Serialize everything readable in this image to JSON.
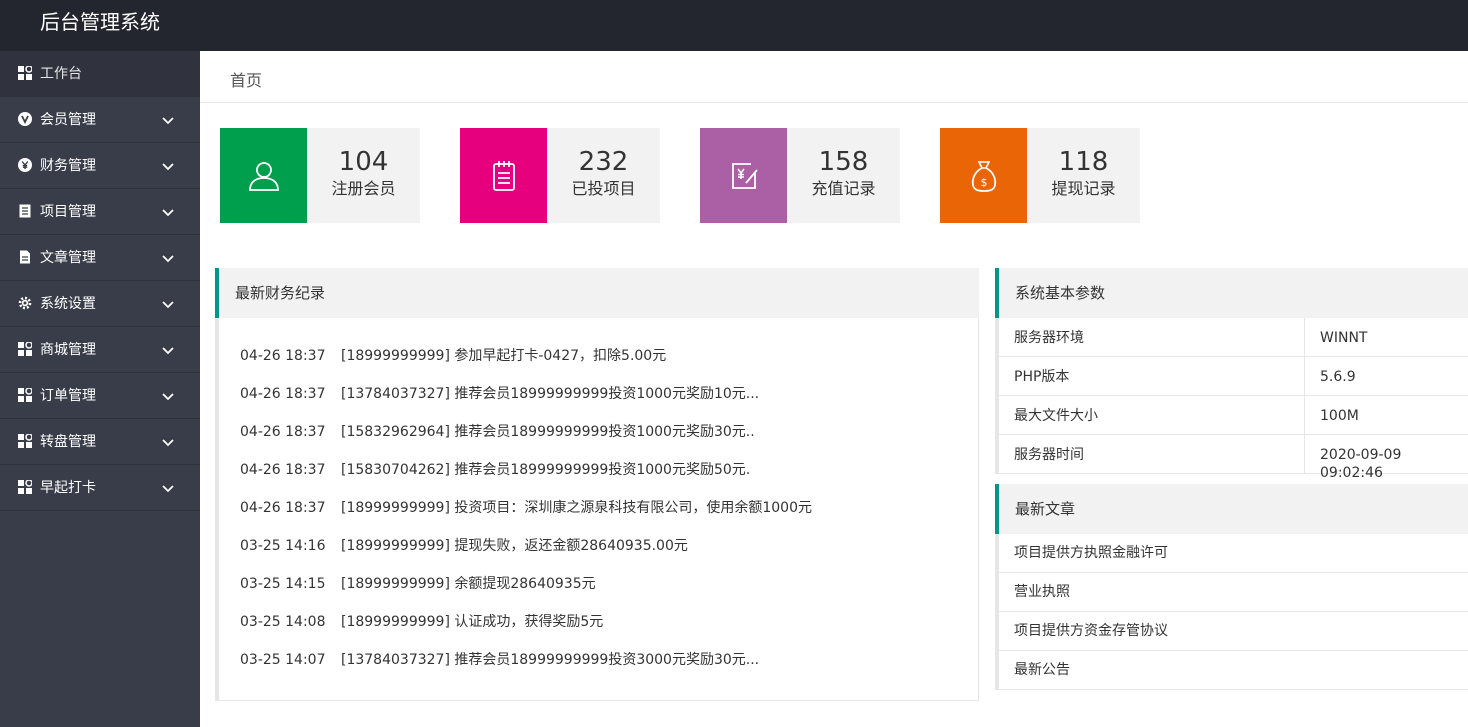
{
  "app": {
    "title": "后台管理系统"
  },
  "sidebar": {
    "items": [
      {
        "label": "工作台",
        "icon": "dashboard-icon"
      },
      {
        "label": "会员管理",
        "icon": "vip-icon"
      },
      {
        "label": "财务管理",
        "icon": "yen-icon"
      },
      {
        "label": "项目管理",
        "icon": "list-icon"
      },
      {
        "label": "文章管理",
        "icon": "document-icon"
      },
      {
        "label": "系统设置",
        "icon": "gear-icon"
      },
      {
        "label": "商城管理",
        "icon": "grid-icon"
      },
      {
        "label": "订单管理",
        "icon": "grid-icon"
      },
      {
        "label": "转盘管理",
        "icon": "grid-icon"
      },
      {
        "label": "早起打卡",
        "icon": "grid-icon"
      }
    ]
  },
  "breadcrumb": {
    "label": "首页"
  },
  "stats": [
    {
      "value": "104",
      "label": "注册会员",
      "color": "#009f4d",
      "icon": "user-icon"
    },
    {
      "value": "232",
      "label": "已投项目",
      "color": "#e6007e",
      "icon": "notepad-icon"
    },
    {
      "value": "158",
      "label": "充值记录",
      "color": "#ab5fa5",
      "icon": "recharge-icon"
    },
    {
      "value": "118",
      "label": "提现记录",
      "color": "#ea6506",
      "icon": "money-bag-icon"
    }
  ],
  "finance": {
    "title": "最新财务纪录",
    "rows": [
      {
        "time": "04-26 18:37",
        "text": "[18999999999] 参加早起打卡-0427，扣除5.00元"
      },
      {
        "time": "04-26 18:37",
        "text": "[13784037327] 推荐会员18999999999投资1000元奖励10元..."
      },
      {
        "time": "04-26 18:37",
        "text": "[15832962964] 推荐会员18999999999投资1000元奖励30元.."
      },
      {
        "time": "04-26 18:37",
        "text": "[15830704262] 推荐会员18999999999投资1000元奖励50元."
      },
      {
        "time": "04-26 18:37",
        "text": "[18999999999] 投资项目：深圳康之源泉科技有限公司，使用余额1000元"
      },
      {
        "time": "03-25 14:16",
        "text": "[18999999999] 提现失败，返还金额28640935.00元"
      },
      {
        "time": "03-25 14:15",
        "text": "[18999999999] 余额提现28640935元"
      },
      {
        "time": "03-25 14:08",
        "text": "[18999999999] 认证成功，获得奖励5元"
      },
      {
        "time": "03-25 14:07",
        "text": "[13784037327] 推荐会员18999999999投资3000元奖励30元..."
      }
    ]
  },
  "params": {
    "title": "系统基本参数",
    "rows": [
      {
        "key": "服务器环境",
        "value": "WINNT"
      },
      {
        "key": "PHP版本",
        "value": "5.6.9"
      },
      {
        "key": "最大文件大小",
        "value": "100M"
      },
      {
        "key": "服务器时间",
        "value": "2020-09-09 09:02:46"
      }
    ]
  },
  "articles": {
    "title": "最新文章",
    "items": [
      "项目提供方执照金融许可",
      "营业执照",
      "项目提供方资金存管协议",
      "最新公告"
    ]
  },
  "colors": {
    "topbar": "#23262e",
    "sidebar": "#393d49",
    "accent": "#009688"
  }
}
